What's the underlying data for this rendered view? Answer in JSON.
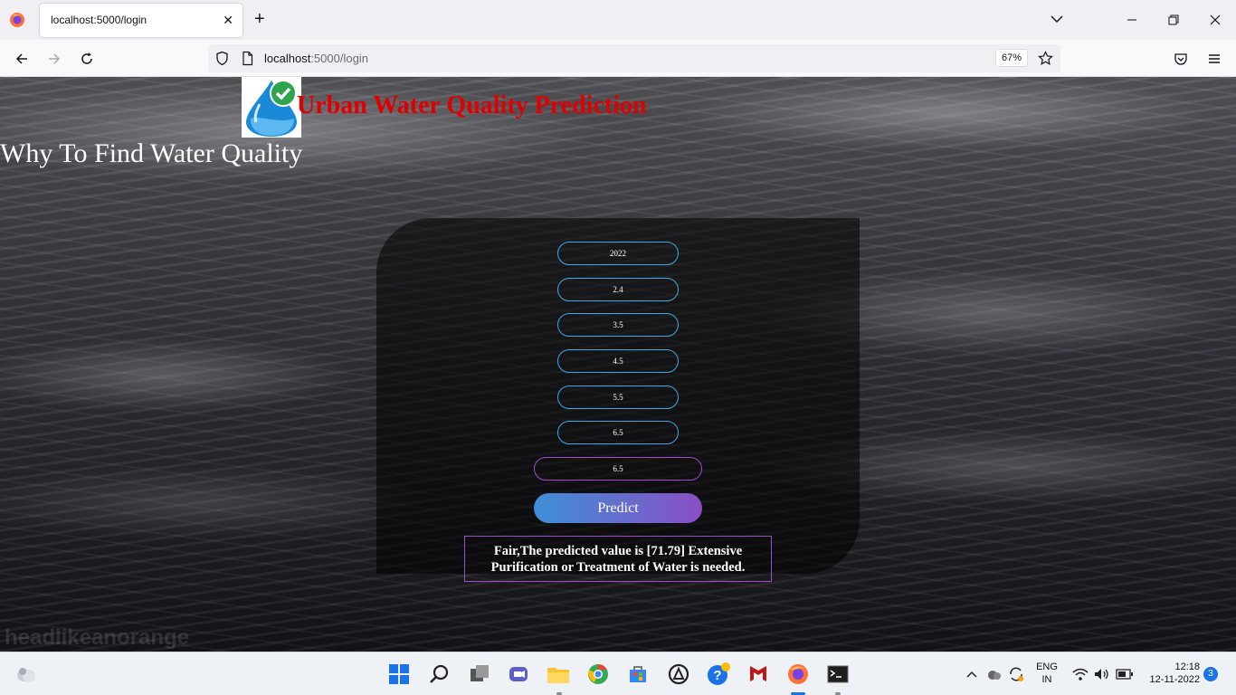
{
  "browser": {
    "tab_title": "localhost:5000/login",
    "url_host": "localhost",
    "url_rest": ":5000/login",
    "zoom": "67%"
  },
  "page": {
    "site_title": "Urban Water Quality Prediction",
    "why_link": "Why To Find Water Quality",
    "watermark": "headlikeanorange",
    "form": {
      "fields": [
        "2022",
        "2.4",
        "3.5",
        "4.5",
        "5.5",
        "6.5",
        "6.5"
      ],
      "predict_label": "Predict"
    },
    "result_text": "Fair,The predicted value is [71.79] Extensive Purification or Treatment of Water is needed."
  },
  "taskbar": {
    "lang_top": "ENG",
    "lang_bottom": "IN",
    "time": "12:18",
    "date": "12-11-2022",
    "notifications": "3"
  },
  "colors": {
    "title_red": "#e00000",
    "field_border": "#3fa9e0",
    "accent_purple": "#9a4fc4"
  }
}
